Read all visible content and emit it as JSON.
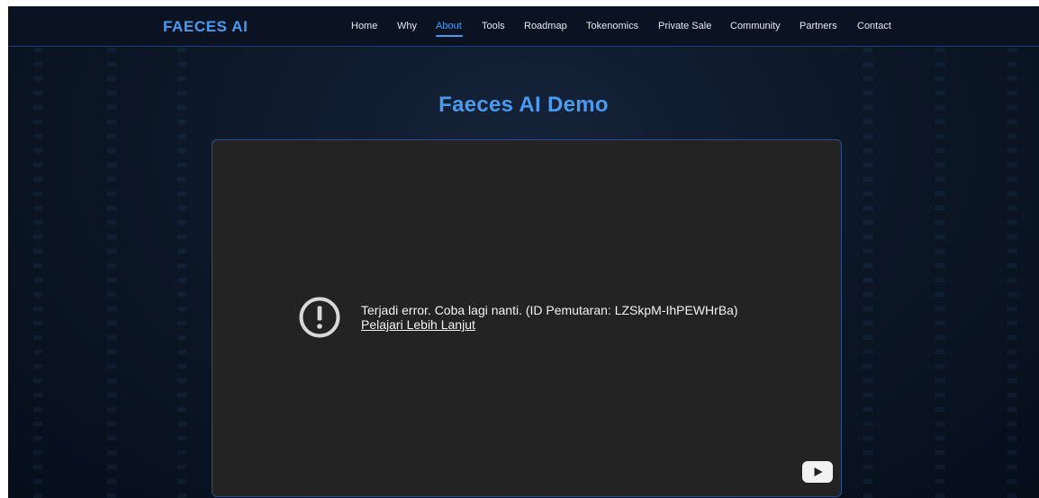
{
  "brand": {
    "name": "FAECES AI"
  },
  "nav": {
    "items": [
      {
        "label": "Home"
      },
      {
        "label": "Why"
      },
      {
        "label": "About"
      },
      {
        "label": "Tools"
      },
      {
        "label": "Roadmap"
      },
      {
        "label": "Tokenomics"
      },
      {
        "label": "Private Sale"
      },
      {
        "label": "Community"
      },
      {
        "label": "Partners"
      },
      {
        "label": "Contact"
      }
    ],
    "active": "About"
  },
  "main": {
    "title": "Faeces AI Demo"
  },
  "video": {
    "error_message": "Terjadi error. Coba lagi nanti. (ID Pemutaran: LZSkpM-IhPEWHrBa)",
    "learn_more": "Pelajari Lebih Lanjut",
    "icons": {
      "error": "exclamation-circle-icon",
      "platform": "youtube-logo-icon"
    }
  },
  "colors": {
    "accent": "#4a9bf0",
    "background": "#0b1322",
    "nav_border": "#1f3f78",
    "player_background": "#232323",
    "player_border": "#2b4d8c",
    "text": "#e4e9f2"
  }
}
